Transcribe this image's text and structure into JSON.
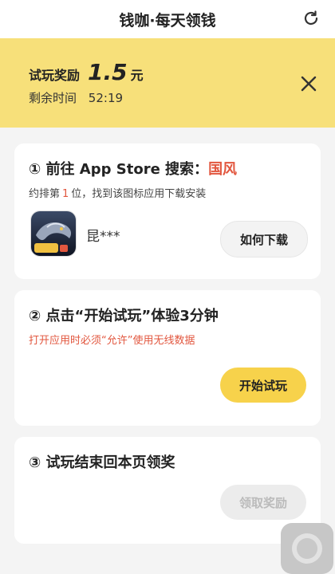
{
  "header": {
    "title": "钱咖·每天领钱",
    "refresh_icon": "refresh-icon"
  },
  "banner": {
    "reward_label": "试玩奖励",
    "reward_amount": "1.5",
    "reward_unit": "元",
    "time_label": "剩余时间",
    "time_value": "52:19",
    "close_icon": "close-icon",
    "bg_color": "#f7e07a"
  },
  "steps": [
    {
      "number": "①",
      "title_prefix": "前往 App Store 搜索：",
      "keyword": "国风",
      "note_prefix": "约排第",
      "rank": "1",
      "note_suffix": "位，找到该图标应用下载安装",
      "app_name": "昆***",
      "button_label": "如何下载"
    },
    {
      "number": "②",
      "title": "点击“开始试玩”体验3分钟",
      "note": "打开应用时必须“允许”使用无线数据",
      "button_label": "开始试玩"
    },
    {
      "number": "③",
      "title": "试玩结束回本页领奖",
      "button_label": "领取奖励"
    }
  ],
  "colors": {
    "accent": "#e2573f",
    "button_yellow": "#f7d24b",
    "disabled": "#ececec"
  },
  "floating_button_icon": "assistive-touch-icon"
}
